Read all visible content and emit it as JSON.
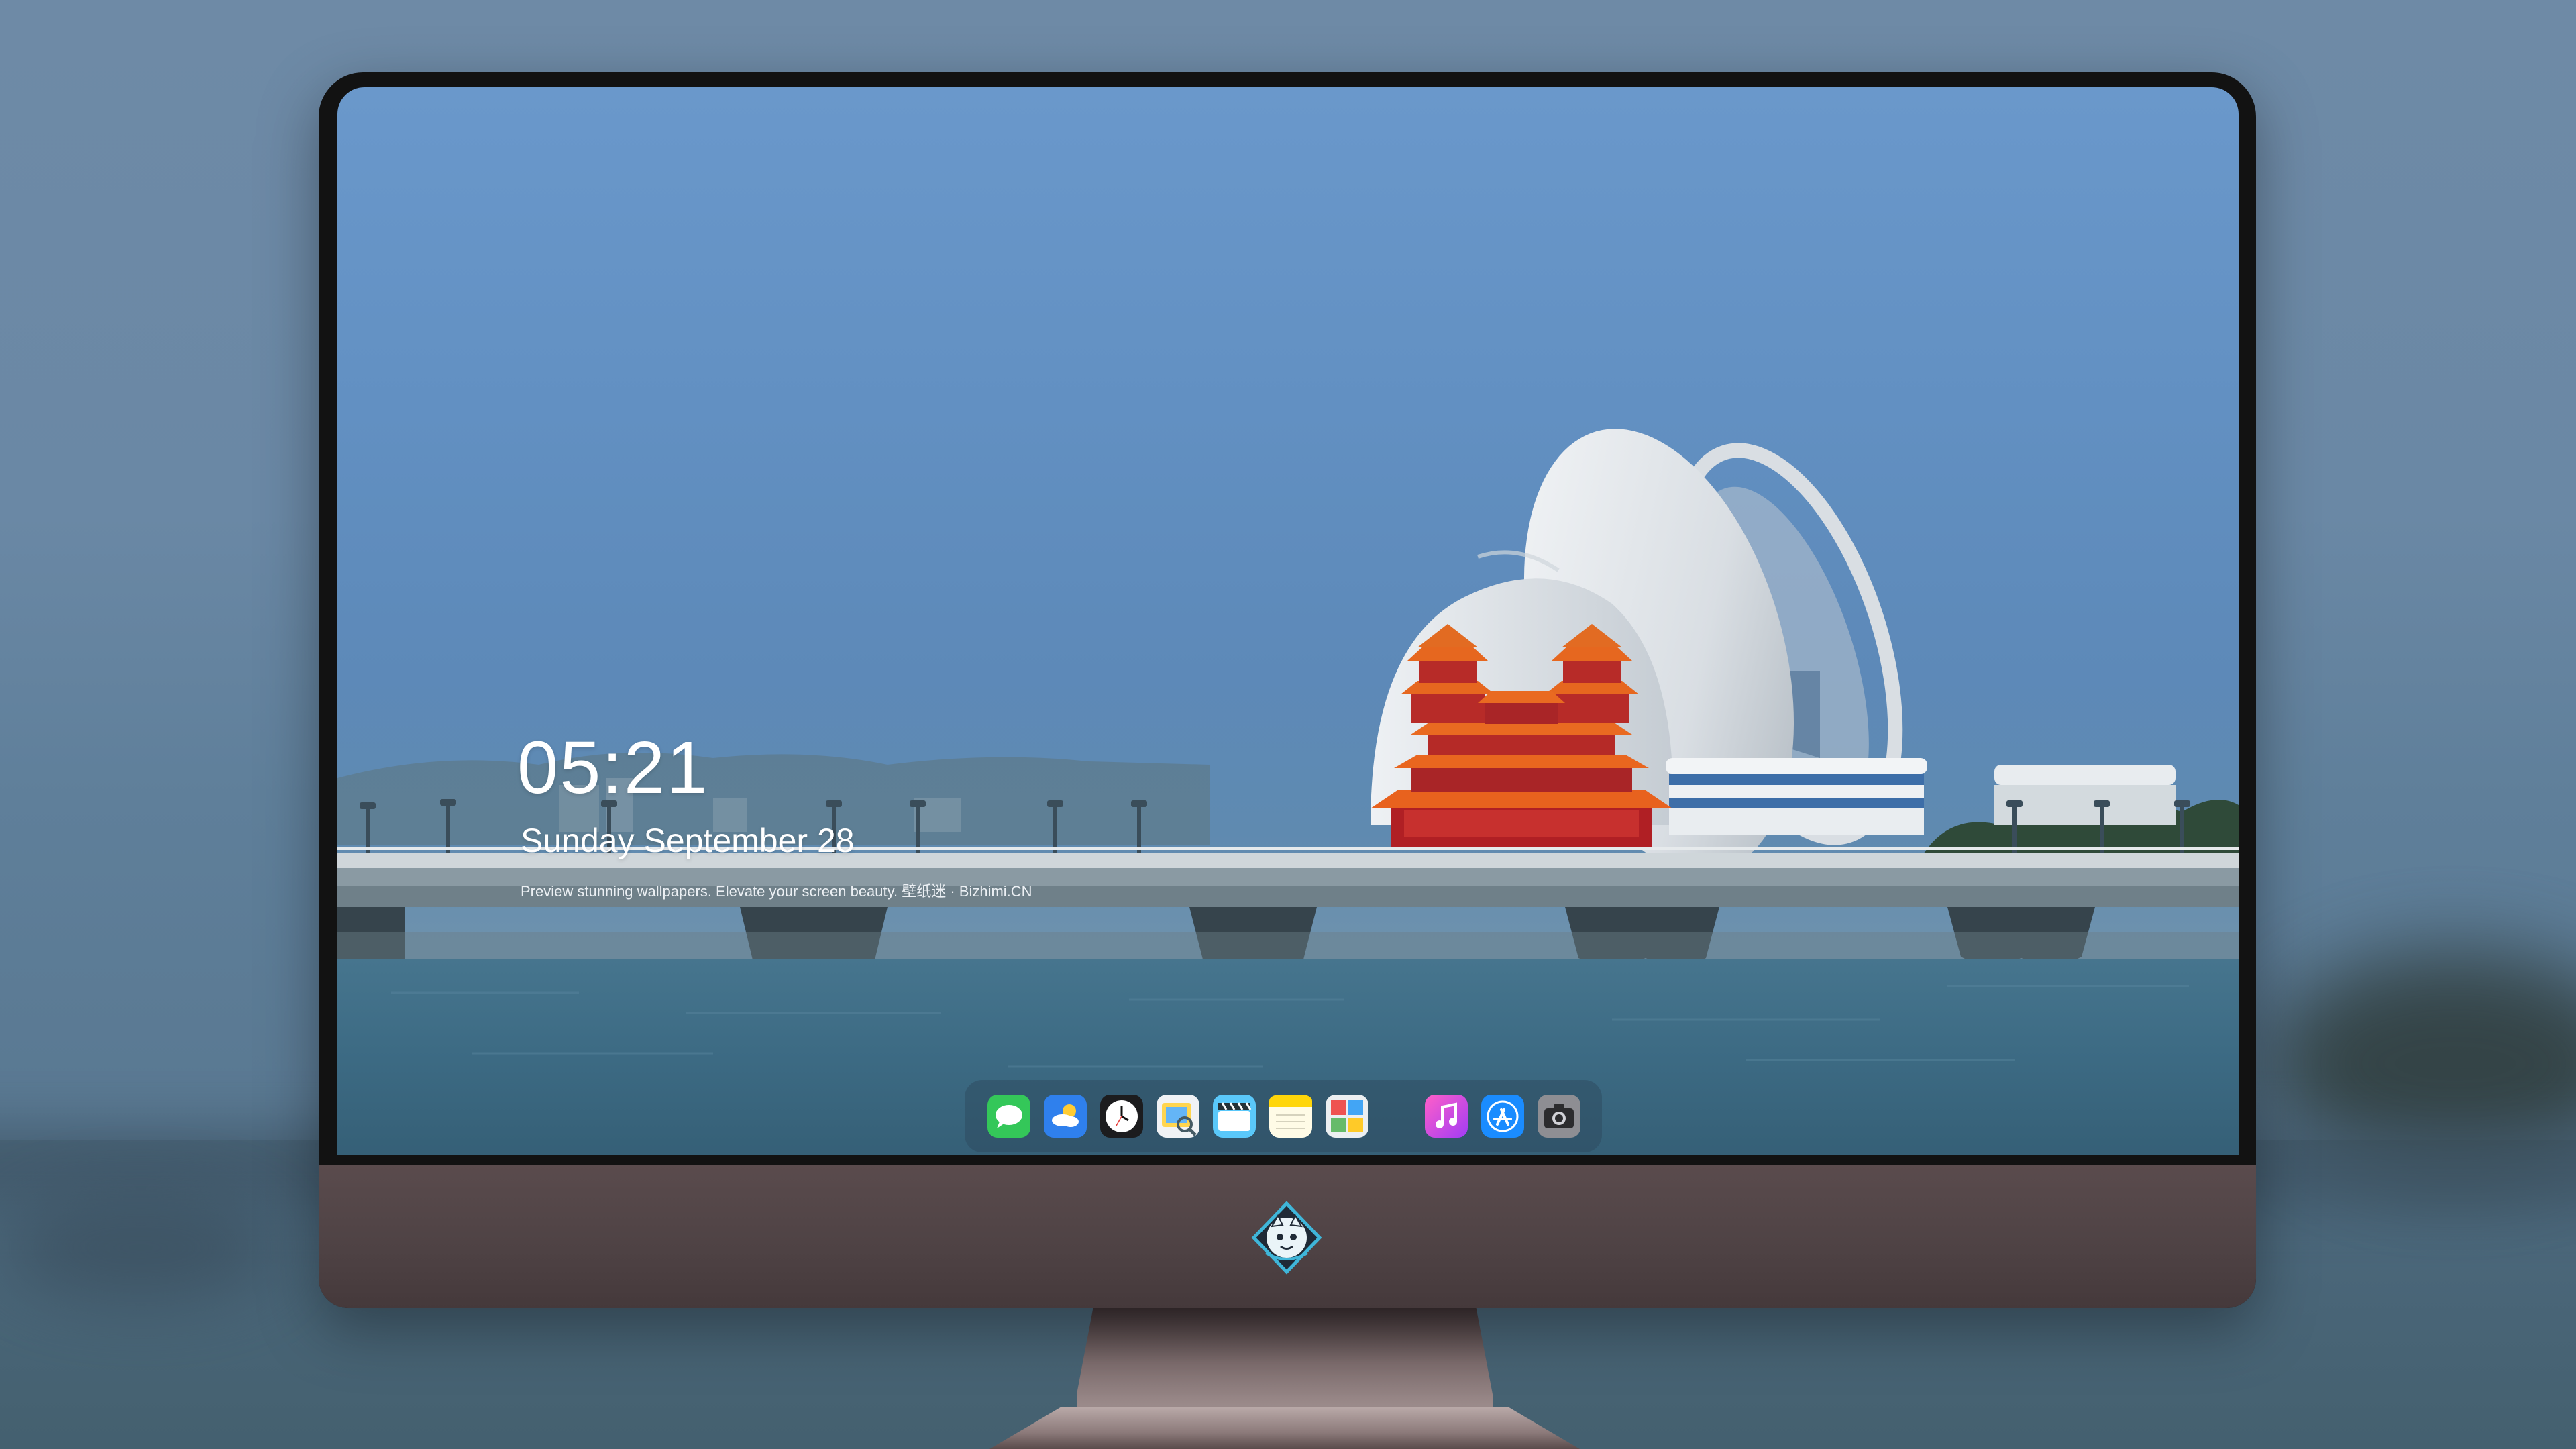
{
  "clock": {
    "time": "05:21",
    "date": "Sunday September  28",
    "tagline": "Preview stunning wallpapers. Elevate your screen beauty. 壁纸迷 · Bizhimi.CN"
  },
  "dock": {
    "apps": [
      {
        "name": "Messages",
        "icon": "messages-icon"
      },
      {
        "name": "Weather",
        "icon": "weather-icon"
      },
      {
        "name": "Clock",
        "icon": "clock-icon"
      },
      {
        "name": "Preview",
        "icon": "preview-icon"
      },
      {
        "name": "Clips",
        "icon": "clapperboard-icon"
      },
      {
        "name": "Notes",
        "icon": "notes-icon"
      },
      {
        "name": "Photo Booth",
        "icon": "photo-booth-icon"
      },
      {
        "name": "iTunes",
        "icon": "music-icon"
      },
      {
        "name": "App Store",
        "icon": "app-store-icon"
      },
      {
        "name": "Camera",
        "icon": "camera-icon"
      }
    ]
  },
  "colors": {
    "sky": "#6a98cb",
    "water": "#3f6c86",
    "monitor_chin": "#4e4244",
    "monitor_bezel": "#121212"
  }
}
